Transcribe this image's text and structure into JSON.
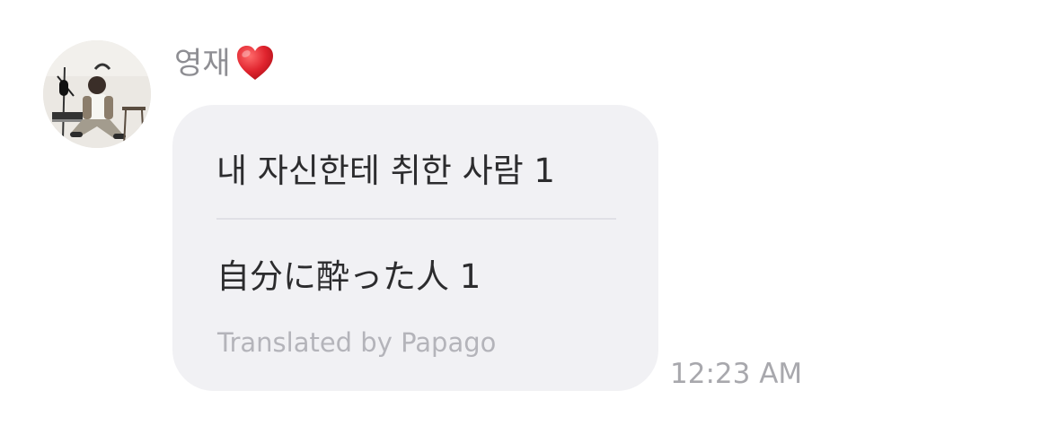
{
  "message": {
    "sender": {
      "name": "영재",
      "emoji_icon": "red-heart-icon",
      "avatar": "profile-photo"
    },
    "original_text": "내 자신한테 취한 사람 1",
    "translated_text": "自分に酔った人 1",
    "translation_credit": "Translated by Papago",
    "timestamp": "12:23 AM"
  },
  "colors": {
    "bubble": "#f1f1f4",
    "sender_name": "#8e8e93",
    "message_text": "#2c2c2e",
    "attribution": "#b4b4ba",
    "timestamp": "#a8a8ad",
    "heart": "#e0242e"
  }
}
